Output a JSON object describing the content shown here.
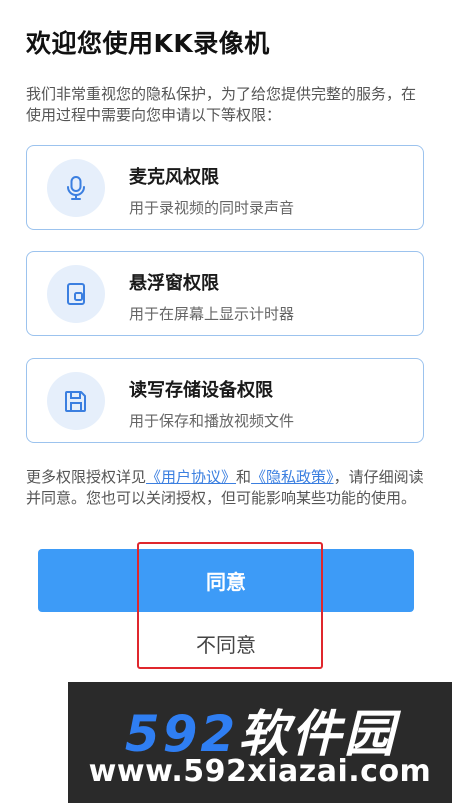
{
  "dialog": {
    "title": "欢迎您使用KK录像机",
    "intro": "我们非常重视您的隐私保护，为了给您提供完整的服务，在使用过程中需要向您申请以下等权限：",
    "permissions": [
      {
        "title": "麦克风权限",
        "desc": "用于录视频的同时录声音",
        "icon": "microphone-icon"
      },
      {
        "title": "悬浮窗权限",
        "desc": "用于在屏幕上显示计时器",
        "icon": "floating-window-icon"
      },
      {
        "title": "读写存储设备权限",
        "desc": "用于保存和播放视频文件",
        "icon": "floppy-disk-icon"
      }
    ],
    "notice": {
      "prefix": "更多权限授权详见",
      "user_agreement": "《用户协议》",
      "and": "和",
      "privacy_policy": "《隐私政策》",
      "suffix": "，请仔细阅读并同意。您也可以关闭授权，但可能影响某些功能的使用。"
    },
    "agree_label": "同意",
    "disagree_label": "不同意"
  },
  "watermark": {
    "logo_number": "592",
    "logo_text": "软件园",
    "url": "www.592xiazai.com"
  },
  "colors": {
    "accent": "#3d9bf7",
    "card_border": "#9cc3ee",
    "icon_bg": "#e6effb",
    "icon_stroke": "#3b7fe0",
    "highlight": "#e0272d",
    "link": "#3b7fe0"
  }
}
